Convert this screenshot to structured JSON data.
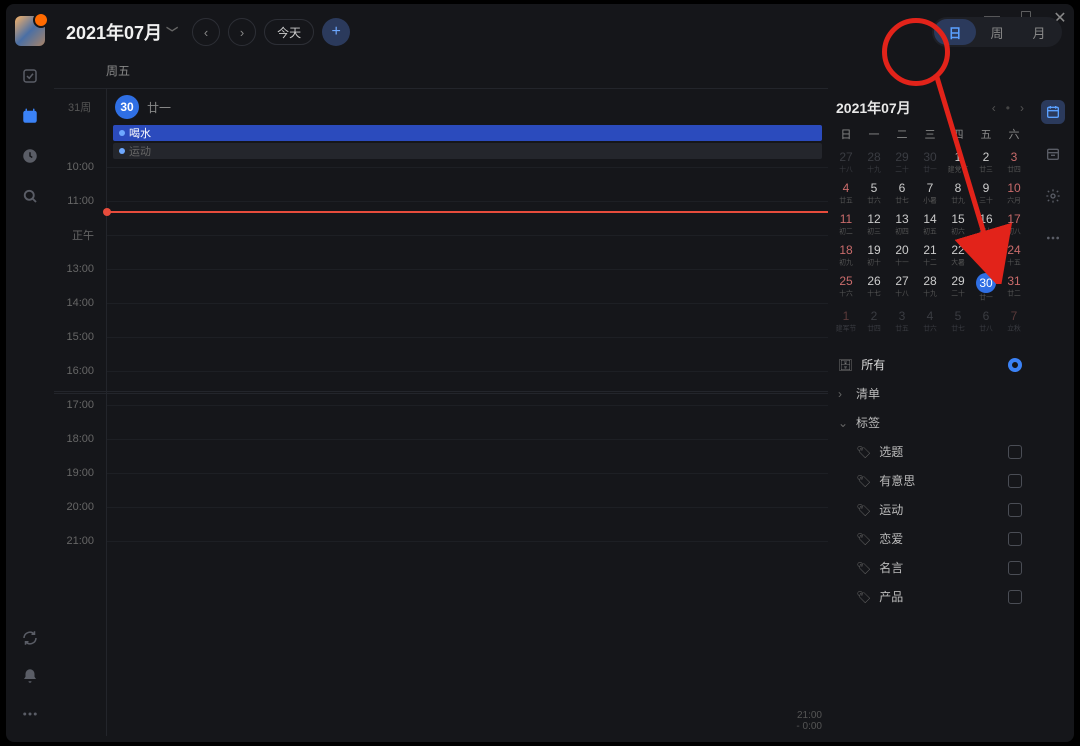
{
  "window": {
    "minimize": "—",
    "maximize": "□",
    "close": "✕"
  },
  "header": {
    "title": "2021年07月",
    "today_label": "今天",
    "weekday": "周五",
    "views": {
      "day": "日",
      "week": "周",
      "month": "月"
    }
  },
  "day": {
    "week_label": "31周",
    "date_num": "30",
    "lunar": "廿一",
    "events": [
      {
        "title": "喝水",
        "faded": false
      },
      {
        "title": "运动",
        "faded": true
      }
    ]
  },
  "timeline": {
    "hours": [
      "10:00",
      "11:00",
      "正午",
      "13:00",
      "14:00",
      "15:00",
      "16:00",
      "17:00",
      "18:00",
      "19:00",
      "20:00",
      "21:00"
    ],
    "end_label": "21:00\n- 0:00"
  },
  "mini": {
    "title": "2021年07月",
    "dow": [
      "日",
      "一",
      "二",
      "三",
      "四",
      "五",
      "六"
    ],
    "cells": [
      {
        "d": "27",
        "s": "十八",
        "out": true
      },
      {
        "d": "28",
        "s": "十九",
        "out": true
      },
      {
        "d": "29",
        "s": "二十",
        "out": true
      },
      {
        "d": "30",
        "s": "廿一",
        "out": true
      },
      {
        "d": "1",
        "s": "建党节"
      },
      {
        "d": "2",
        "s": "廿三"
      },
      {
        "d": "3",
        "s": "廿四",
        "wk": true
      },
      {
        "d": "4",
        "s": "廿五",
        "wk": true
      },
      {
        "d": "5",
        "s": "廿六"
      },
      {
        "d": "6",
        "s": "廿七"
      },
      {
        "d": "7",
        "s": "小暑"
      },
      {
        "d": "8",
        "s": "廿九"
      },
      {
        "d": "9",
        "s": "三十"
      },
      {
        "d": "10",
        "s": "六月",
        "wk": true
      },
      {
        "d": "11",
        "s": "初二",
        "wk": true
      },
      {
        "d": "12",
        "s": "初三"
      },
      {
        "d": "13",
        "s": "初四"
      },
      {
        "d": "14",
        "s": "初五"
      },
      {
        "d": "15",
        "s": "初六"
      },
      {
        "d": "16",
        "s": "初七"
      },
      {
        "d": "17",
        "s": "初八",
        "wk": true
      },
      {
        "d": "18",
        "s": "初九",
        "wk": true
      },
      {
        "d": "19",
        "s": "初十"
      },
      {
        "d": "20",
        "s": "十一"
      },
      {
        "d": "21",
        "s": "十二"
      },
      {
        "d": "22",
        "s": "大暑"
      },
      {
        "d": "23",
        "s": "十四"
      },
      {
        "d": "24",
        "s": "十五",
        "wk": true
      },
      {
        "d": "25",
        "s": "十六",
        "wk": true
      },
      {
        "d": "26",
        "s": "十七"
      },
      {
        "d": "27",
        "s": "十八"
      },
      {
        "d": "28",
        "s": "十九"
      },
      {
        "d": "29",
        "s": "二十"
      },
      {
        "d": "30",
        "s": "廿一",
        "today": true
      },
      {
        "d": "31",
        "s": "廿二",
        "wk": true
      },
      {
        "d": "1",
        "s": "建军节",
        "out": true,
        "wk": true
      },
      {
        "d": "2",
        "s": "廿四",
        "out": true
      },
      {
        "d": "3",
        "s": "廿五",
        "out": true
      },
      {
        "d": "4",
        "s": "廿六",
        "out": true
      },
      {
        "d": "5",
        "s": "廿七",
        "out": true
      },
      {
        "d": "6",
        "s": "廿八",
        "out": true
      },
      {
        "d": "7",
        "s": "立秋",
        "out": true,
        "wk": true
      }
    ]
  },
  "filters": {
    "all": "所有",
    "lists": "清单",
    "tags_label": "标签",
    "tags": [
      "选题",
      "有意思",
      "运动",
      "恋爱",
      "名言",
      "产品"
    ]
  }
}
